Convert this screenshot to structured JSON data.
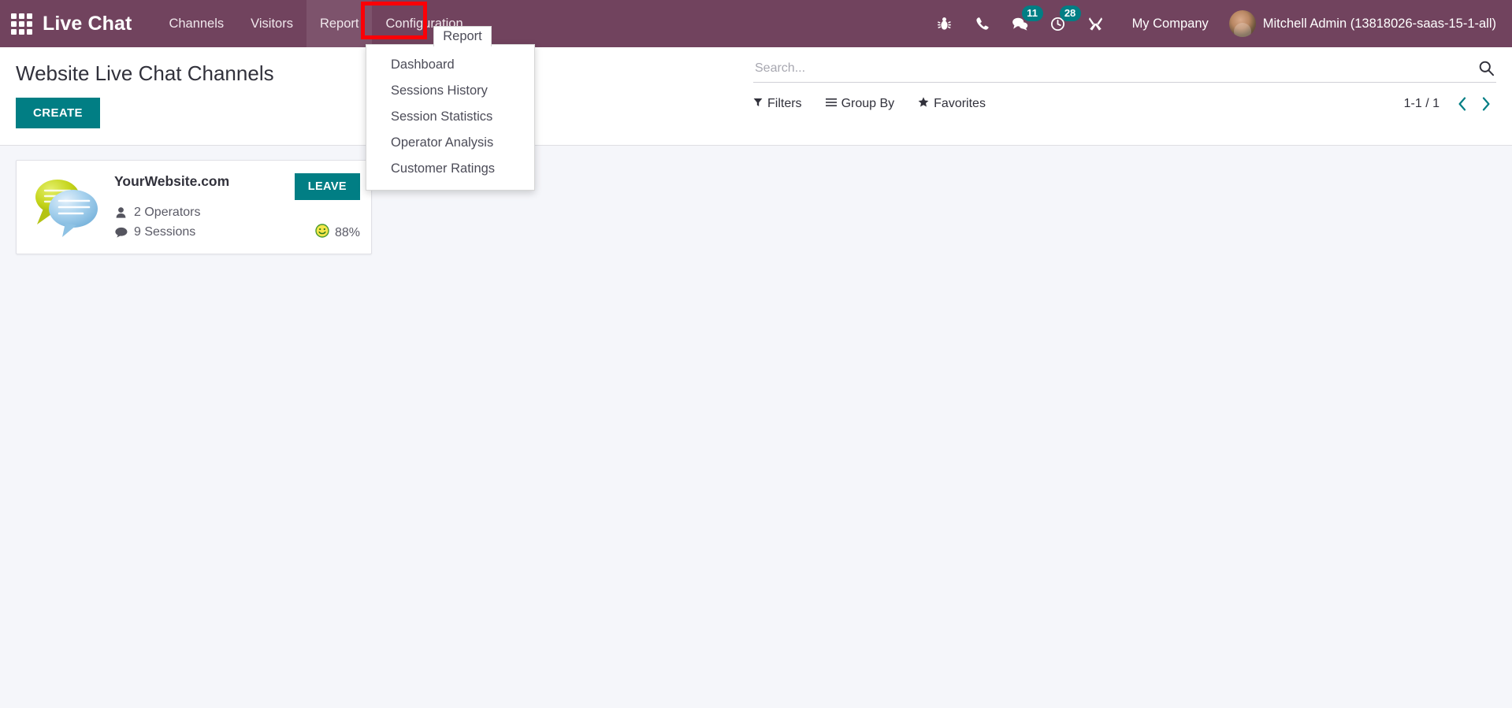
{
  "navbar": {
    "apps_icon": "apps-grid-icon",
    "brand": "Live Chat",
    "menus": [
      {
        "label": "Channels",
        "name": "nav-item-channels"
      },
      {
        "label": "Visitors",
        "name": "nav-item-visitors"
      },
      {
        "label": "Report",
        "name": "nav-item-report",
        "active": true
      },
      {
        "label": "Configuration",
        "name": "nav-item-configuration"
      }
    ],
    "tooltip": "Report",
    "systray": [
      {
        "icon": "bug-icon",
        "badge": null
      },
      {
        "icon": "phone-icon",
        "badge": null
      },
      {
        "icon": "messages-icon",
        "badge": "11"
      },
      {
        "icon": "activities-clock-icon",
        "badge": "28"
      },
      {
        "icon": "tools-icon",
        "badge": null
      }
    ],
    "company": "My Company",
    "user": "Mitchell Admin (13818026-saas-15-1-all)"
  },
  "dropdown": {
    "items": [
      "Dashboard",
      "Sessions History",
      "Session Statistics",
      "Operator Analysis",
      "Customer Ratings"
    ]
  },
  "control_panel": {
    "title": "Website Live Chat Channels",
    "create_label": "CREATE",
    "search_placeholder": "Search...",
    "search_value": "",
    "filters_label": "Filters",
    "group_by_label": "Group By",
    "favorites_label": "Favorites",
    "pager_count": "1-1 / 1"
  },
  "kanban": {
    "cards": [
      {
        "title": "YourWebsite.com",
        "operators": "2 Operators",
        "sessions": "9 Sessions",
        "rating": "88%",
        "leave_label": "LEAVE"
      }
    ]
  },
  "colors": {
    "navbar": "#71435e",
    "accent_teal": "#017e84",
    "highlight_red": "#fb0007",
    "kanban_bg": "#f5f6fa"
  }
}
